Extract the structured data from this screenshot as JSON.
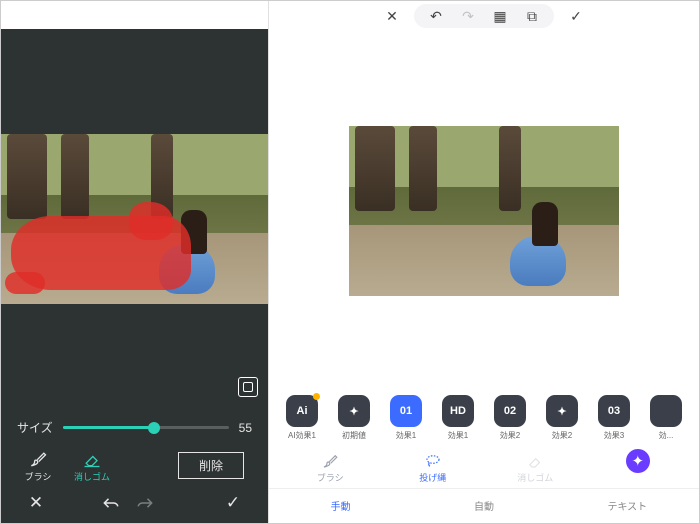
{
  "left": {
    "slider": {
      "label": "サイズ",
      "value": "55",
      "percent": 55
    },
    "tools": {
      "brush": "ブラシ",
      "eraser": "消しゴム"
    },
    "delete_label": "削除"
  },
  "right": {
    "effects": [
      {
        "id": "ai",
        "chip": "Ai",
        "label": "AI効果1",
        "badge": true
      },
      {
        "id": "init",
        "chip": "✦",
        "label": "初期値"
      },
      {
        "id": "e1",
        "chip": "01",
        "label": "効果1",
        "active": true
      },
      {
        "id": "hd",
        "chip": "HD",
        "label": "効果1"
      },
      {
        "id": "e2",
        "chip": "02",
        "label": "効果2"
      },
      {
        "id": "e2b",
        "chip": "✦",
        "label": "効果2"
      },
      {
        "id": "e3",
        "chip": "03",
        "label": "効果3"
      },
      {
        "id": "ex",
        "chip": "",
        "label": "効..."
      }
    ],
    "modes": {
      "brush": "ブラシ",
      "lasso": "投げ縄",
      "eraser": "消しゴム"
    },
    "tabs": {
      "manual": "手動",
      "auto": "自動",
      "text": "テキスト"
    }
  }
}
